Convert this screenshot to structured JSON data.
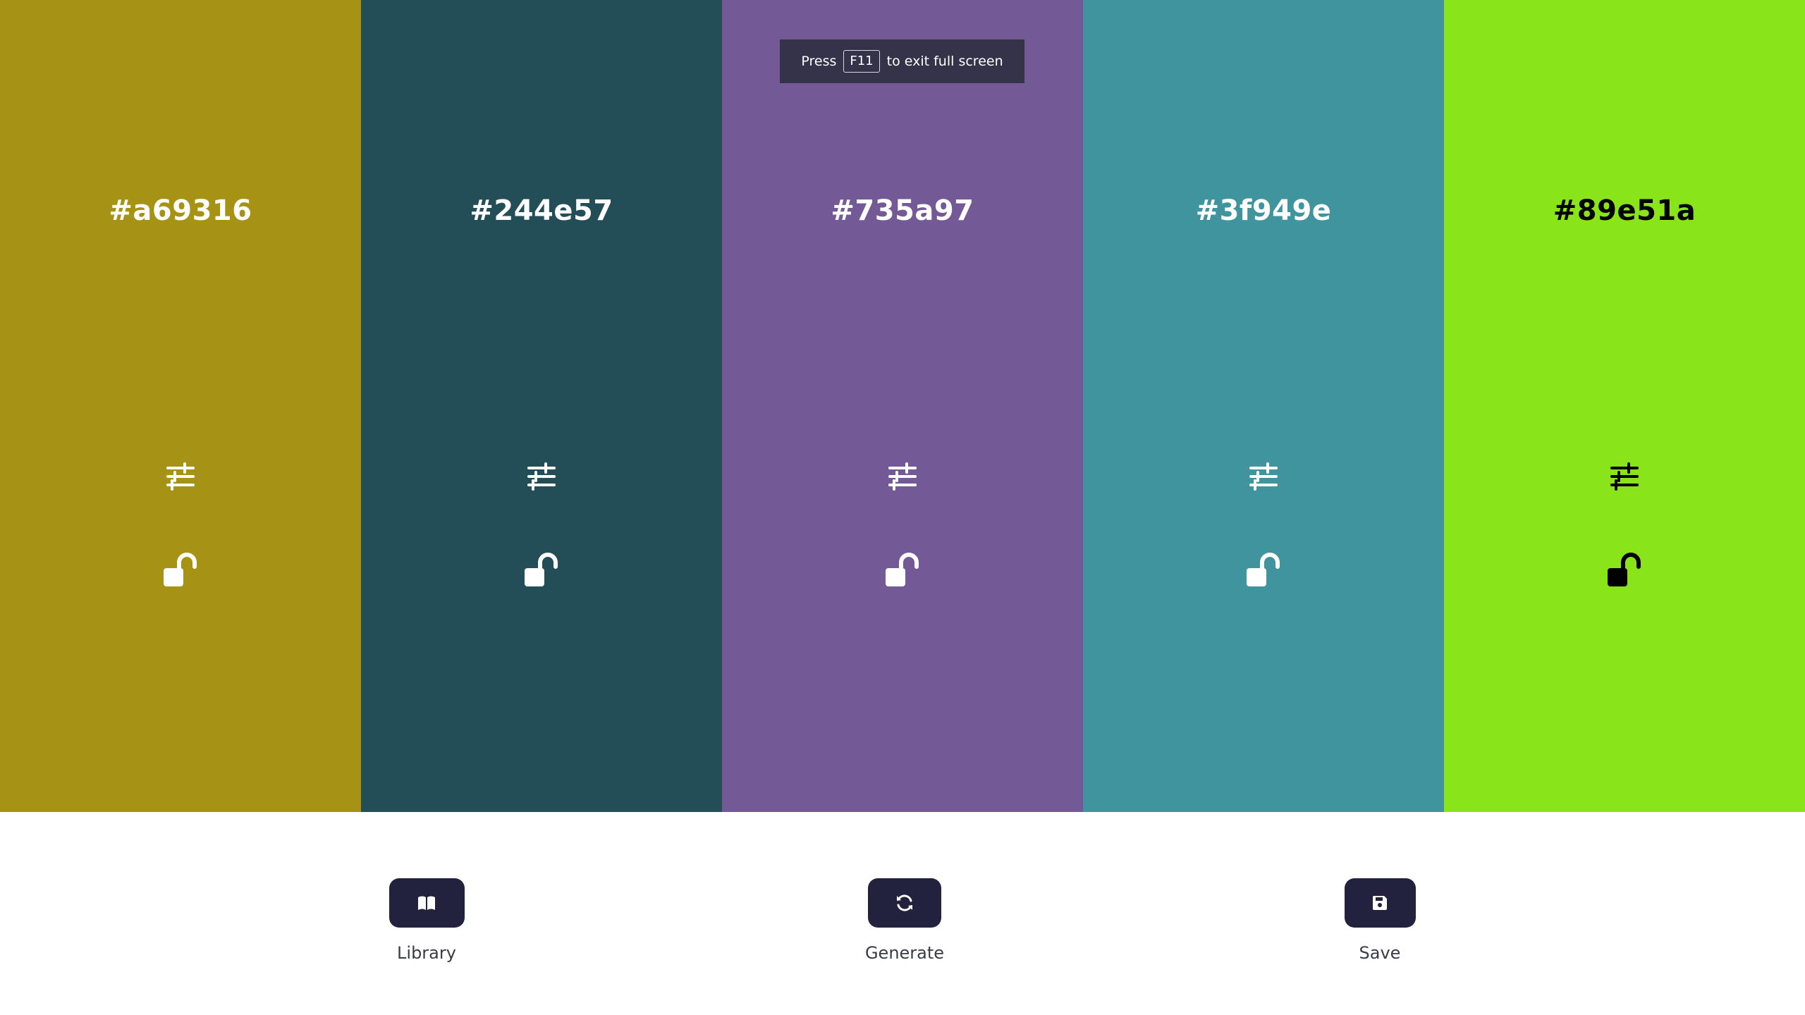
{
  "palette": {
    "colors": [
      {
        "hex": "#a69316",
        "text_color": "#ffffff",
        "adjust_icon": "sliders-icon",
        "lock_icon": "unlock-icon"
      },
      {
        "hex": "#244e57",
        "text_color": "#ffffff",
        "adjust_icon": "sliders-icon",
        "lock_icon": "unlock-icon"
      },
      {
        "hex": "#735a97",
        "text_color": "#ffffff",
        "adjust_icon": "sliders-icon",
        "lock_icon": "unlock-icon"
      },
      {
        "hex": "#3f949e",
        "text_color": "#ffffff",
        "adjust_icon": "sliders-icon",
        "lock_icon": "unlock-icon"
      },
      {
        "hex": "#89e51a",
        "text_color": "#000000",
        "adjust_icon": "sliders-icon",
        "lock_icon": "unlock-icon"
      }
    ]
  },
  "fullscreen_hint": {
    "prefix": "Press",
    "key": "F11",
    "suffix": "to exit full screen"
  },
  "toolbar": {
    "library": {
      "label": "Library",
      "icon": "book-icon"
    },
    "generate": {
      "label": "Generate",
      "icon": "refresh-icon"
    },
    "save": {
      "label": "Save",
      "icon": "save-icon"
    }
  },
  "theme": {
    "button_bg": "#22223f",
    "hint_bg": "#35334a"
  }
}
